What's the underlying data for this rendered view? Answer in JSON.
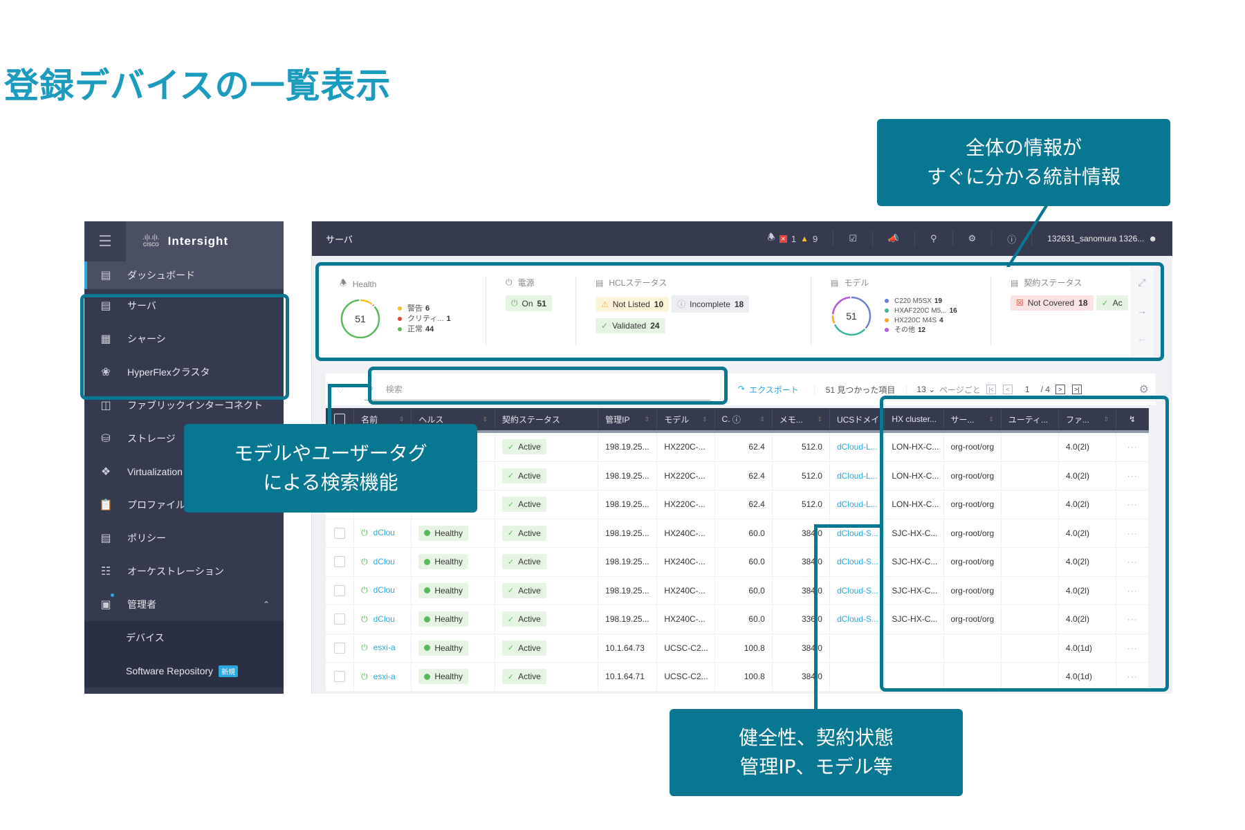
{
  "page_title": "登録デバイスの一覧表示",
  "sidebar": {
    "brand": "Intersight",
    "cisco_logo_text": "cisco",
    "items": [
      {
        "label": "ダッシュボード",
        "icon": "bar-chart-icon"
      },
      {
        "label": "サーバ",
        "icon": "server-icon"
      },
      {
        "label": "シャーシ",
        "icon": "chassis-icon"
      },
      {
        "label": "HyperFlexクラスタ",
        "icon": "cluster-icon"
      },
      {
        "label": "ファブリックインターコネクト",
        "icon": "fabric-icon"
      },
      {
        "label": "ストレージ",
        "icon": "storage-icon"
      },
      {
        "label": "Virtualization",
        "icon": "virtualization-icon"
      },
      {
        "label": "プロファイル",
        "icon": "profile-icon"
      },
      {
        "label": "ポリシー",
        "icon": "policy-icon"
      },
      {
        "label": "オーケストレーション",
        "icon": "orchestration-icon"
      },
      {
        "label": "管理者",
        "icon": "admin-icon"
      }
    ],
    "admin_sub": [
      {
        "label": "デバイス"
      },
      {
        "label": "Software Repository",
        "badge": "新規"
      }
    ]
  },
  "topbar": {
    "title": "サーバ",
    "critical_count": "1",
    "warning_count": "9",
    "user": "132631_sanomura 1326..."
  },
  "stats": {
    "health": {
      "label": "Health",
      "total": "51",
      "legend": [
        {
          "label": "警告",
          "value": "6",
          "color": "#f6c026"
        },
        {
          "label": "クリティ...",
          "value": "1",
          "color": "#e2453b"
        },
        {
          "label": "正常",
          "value": "44",
          "color": "#5cb85c"
        }
      ]
    },
    "power": {
      "label": "電源",
      "chip_label": "On",
      "chip_value": "51"
    },
    "hcl": {
      "label": "HCLステータス",
      "chips": [
        {
          "label": "Not Listed",
          "value": "10",
          "kind": "yellow"
        },
        {
          "label": "Incomplete",
          "value": "18",
          "kind": "grey"
        },
        {
          "label": "Validated",
          "value": "24",
          "kind": "green"
        }
      ]
    },
    "model": {
      "label": "モデル",
      "total": "51",
      "legend": [
        {
          "label": "C220 M5SX",
          "value": "19",
          "color": "#6c7fd6"
        },
        {
          "label": "HXAF220C M5...",
          "value": "16",
          "color": "#3bb39a"
        },
        {
          "label": "HX220C M4S",
          "value": "4",
          "color": "#f6a623"
        },
        {
          "label": "その他",
          "value": "12",
          "color": "#b05cd6"
        }
      ]
    },
    "contract": {
      "label": "契約ステータス",
      "chips": [
        {
          "label": "Not Covered",
          "value": "18",
          "kind": "red"
        },
        {
          "label": "Ac",
          "value": "",
          "kind": "green"
        }
      ]
    }
  },
  "toolbar": {
    "search_placeholder": "検索",
    "export_label": "エクスポート",
    "found_text": "51 見つかった項目",
    "per_page": "13",
    "per_page_label": "ページごと",
    "page_current": "1",
    "page_total": "/ 4"
  },
  "table": {
    "columns": [
      "名前",
      "ヘルス",
      "契約ステータス",
      "管理IP",
      "モデル",
      "C.",
      "メモ...",
      "UCSドメイ",
      "HX cluster...",
      "サー...",
      "ユーティ...",
      "ファ...",
      ""
    ],
    "rows": [
      {
        "name": "",
        "health": "",
        "contract": "Active",
        "ip": "198.19.25...",
        "model": "HX220C-...",
        "cpu": "62.4",
        "mem": "512.0",
        "domain": "dCloud-L...",
        "hx": "LON-HX-C...",
        "server": "org-root/org",
        "util": "",
        "fw": "4.0(2l)"
      },
      {
        "name": "",
        "health": "",
        "contract": "Active",
        "ip": "198.19.25...",
        "model": "HX220C-...",
        "cpu": "62.4",
        "mem": "512.0",
        "domain": "dCloud-L...",
        "hx": "LON-HX-C...",
        "server": "org-root/org",
        "util": "",
        "fw": "4.0(2l)"
      },
      {
        "name": "",
        "health": "",
        "contract": "Active",
        "ip": "198.19.25...",
        "model": "HX220C-...",
        "cpu": "62.4",
        "mem": "512.0",
        "domain": "dCloud-L...",
        "hx": "LON-HX-C...",
        "server": "org-root/org",
        "util": "",
        "fw": "4.0(2l)"
      },
      {
        "name": "dClou",
        "health": "Healthy",
        "contract": "Active",
        "ip": "198.19.25...",
        "model": "HX240C-...",
        "cpu": "60.0",
        "mem": "384.0",
        "domain": "dCloud-S...",
        "hx": "SJC-HX-C...",
        "server": "org-root/org",
        "util": "",
        "fw": "4.0(2l)"
      },
      {
        "name": "dClou",
        "health": "Healthy",
        "contract": "Active",
        "ip": "198.19.25...",
        "model": "HX240C-...",
        "cpu": "60.0",
        "mem": "384.0",
        "domain": "dCloud-S...",
        "hx": "SJC-HX-C...",
        "server": "org-root/org",
        "util": "",
        "fw": "4.0(2l)"
      },
      {
        "name": "dClou",
        "health": "Healthy",
        "contract": "Active",
        "ip": "198.19.25...",
        "model": "HX240C-...",
        "cpu": "60.0",
        "mem": "384.0",
        "domain": "dCloud-S...",
        "hx": "SJC-HX-C...",
        "server": "org-root/org",
        "util": "",
        "fw": "4.0(2l)"
      },
      {
        "name": "dClou",
        "health": "Healthy",
        "contract": "Active",
        "ip": "198.19.25...",
        "model": "HX240C-...",
        "cpu": "60.0",
        "mem": "336.0",
        "domain": "dCloud-S...",
        "hx": "SJC-HX-C...",
        "server": "org-root/org",
        "util": "",
        "fw": "4.0(2l)"
      },
      {
        "name": "esxi-a",
        "health": "Healthy",
        "contract": "Active",
        "ip": "10.1.64.73",
        "model": "UCSC-C2...",
        "cpu": "100.8",
        "mem": "384.0",
        "domain": "",
        "hx": "",
        "server": "",
        "util": "",
        "fw": "4.0(1d)"
      },
      {
        "name": "esxi-a",
        "health": "Healthy",
        "contract": "Active",
        "ip": "10.1.64.71",
        "model": "UCSC-C2...",
        "cpu": "100.8",
        "mem": "384.0",
        "domain": "",
        "hx": "",
        "server": "",
        "util": "",
        "fw": "4.0(1d)"
      }
    ]
  },
  "callouts": {
    "stats": "全体の情報が\nすぐに分かる統計情報",
    "search": "モデルやユーザータグ\nによる検索機能",
    "columns": "健全性、契約状態\n管理IP、モデル等"
  },
  "colors": {
    "accent": "#087791",
    "title": "#1b9bbd",
    "sidebar_bg": "#353a4f",
    "link": "#2aa8e0",
    "healthy": "#5cb85c"
  }
}
